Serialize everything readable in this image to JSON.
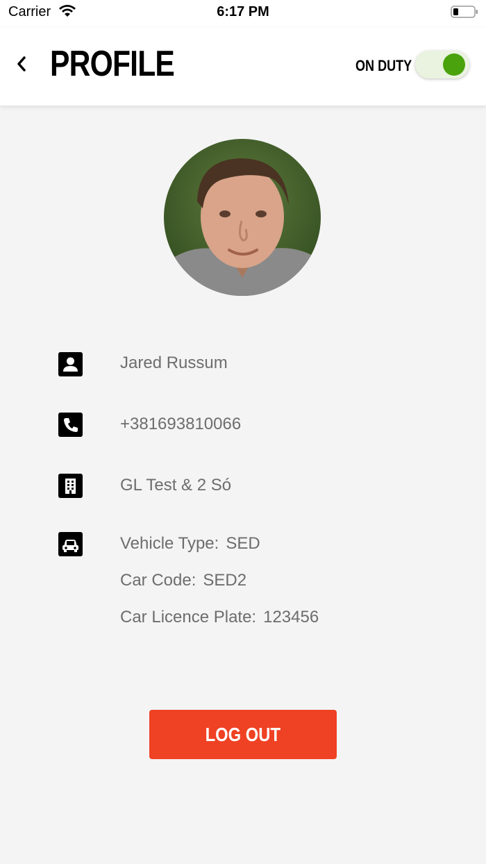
{
  "status_bar": {
    "carrier": "Carrier",
    "time": "6:17 PM",
    "icons": [
      "wifi-icon",
      "battery-icon"
    ]
  },
  "header": {
    "title": "PROFILE",
    "back_icon": "chevron-left-icon",
    "duty_label": "ON DUTY",
    "duty_on": true,
    "toggle_color": "#4aa20d"
  },
  "profile": {
    "name": "Jared Russum",
    "phone": "+381693810066",
    "company": "GL Test & 2 Só",
    "icons": [
      "person-icon",
      "phone-icon",
      "building-icon",
      "car-icon"
    ],
    "vehicle": [
      {
        "label": "Vehicle Type:",
        "value": "SED"
      },
      {
        "label": "Car Code:",
        "value": "SED2"
      },
      {
        "label": "Car Licence Plate:",
        "value": "123456"
      }
    ]
  },
  "actions": {
    "logout_label": "LOG OUT",
    "logout_color": "#ef4123"
  }
}
